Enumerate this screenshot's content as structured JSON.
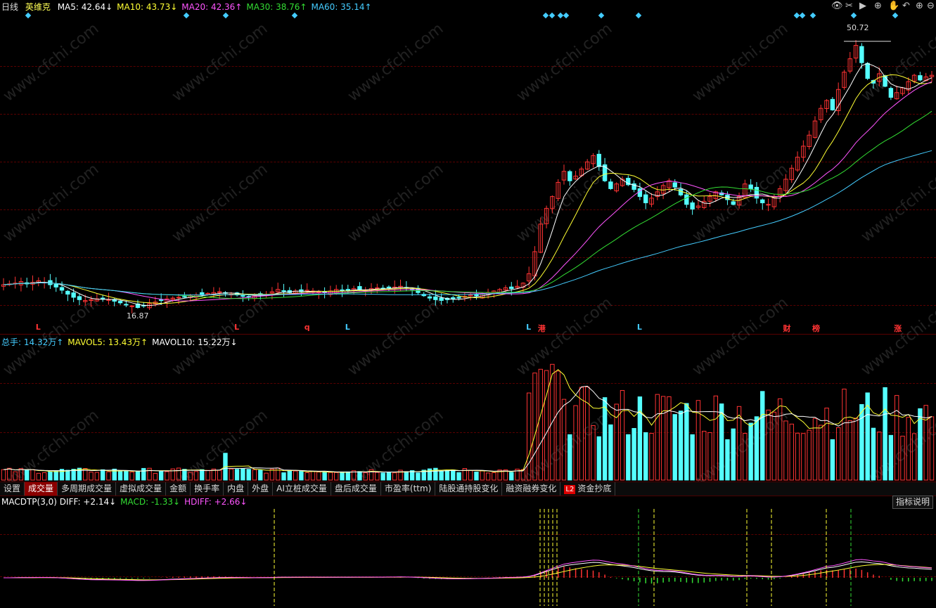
{
  "header": {
    "period": "日线",
    "stock_name": "英维克",
    "ma": [
      {
        "label": "MA5: 42.64",
        "arrow": "↓",
        "color": "#ffffff"
      },
      {
        "label": "MA10: 43.73",
        "arrow": "↓",
        "color": "#ffff33"
      },
      {
        "label": "MA20: 42.36",
        "arrow": "↑",
        "color": "#ff55ff"
      },
      {
        "label": "MA30: 38.76",
        "arrow": "↑",
        "color": "#33dd33"
      },
      {
        "label": "MA60: 35.14",
        "arrow": "↑",
        "color": "#44ccff"
      }
    ]
  },
  "toolbar_icons": [
    "eye-icon",
    "scissors-icon",
    "play-icon",
    "crosshair-icon",
    "hand-icon",
    "undo-icon",
    "zoom-in-icon",
    "zoom-out-icon"
  ],
  "annotations": {
    "high": "50.72",
    "low": "16.87"
  },
  "signals": [
    {
      "text": "L",
      "color": "#ff3333",
      "idx": 6
    },
    {
      "text": "L",
      "color": "#ff3333",
      "idx": 40
    },
    {
      "text": "q",
      "color": "#ff3333",
      "idx": 52
    },
    {
      "text": "L",
      "color": "#44ccff",
      "idx": 59
    },
    {
      "text": "L",
      "color": "#44ccff",
      "idx": 90
    },
    {
      "text": "港",
      "color": "#ff3333",
      "idx": 92
    },
    {
      "text": "L",
      "color": "#44ccff",
      "idx": 109
    },
    {
      "text": "财",
      "color": "#ff3333",
      "idx": 134
    },
    {
      "text": "榜",
      "color": "#ff3333",
      "idx": 139
    },
    {
      "text": "涨",
      "color": "#ff3333",
      "idx": 153
    }
  ],
  "volume_legend": [
    {
      "label": "总手: 14.32万",
      "arrow": "↑",
      "color": "#44ccff"
    },
    {
      "label": "MAVOL5: 13.43万",
      "arrow": "↑",
      "color": "#ffff33"
    },
    {
      "label": "MAVOL10: 15.22万",
      "arrow": "↓",
      "color": "#ffffff"
    }
  ],
  "tabs": [
    {
      "label": "设置",
      "active": false
    },
    {
      "label": "成交量",
      "active": true
    },
    {
      "label": "多周期成交量",
      "active": false
    },
    {
      "label": "虚拟成交量",
      "active": false
    },
    {
      "label": "金额",
      "active": false
    },
    {
      "label": "换手率",
      "active": false
    },
    {
      "label": "内盘",
      "active": false
    },
    {
      "label": "外盘",
      "active": false
    },
    {
      "label": "AI立桩成交量",
      "active": false
    },
    {
      "label": "盘后成交量",
      "active": false
    },
    {
      "label": "市盈率(ttm)",
      "active": false
    },
    {
      "label": "陆股通持股变化",
      "active": false
    },
    {
      "label": "融资融券变化",
      "active": false
    },
    {
      "label": "资金抄底",
      "active": false,
      "badge": "L2"
    }
  ],
  "macd_legend": [
    {
      "label": "MACDTP(3,0) DIFF: +2.14",
      "arrow": "↓",
      "color": "#ffffff"
    },
    {
      "label": "MACD: -1.33",
      "arrow": "↓",
      "color": "#33dd33"
    },
    {
      "label": "HDIFF: +2.66",
      "arrow": "↓",
      "color": "#ff55ff"
    }
  ],
  "explain_button": "指标说明",
  "watermark": "www.cfchi.com",
  "colors": {
    "up": "#ff3333",
    "down": "#55ffff",
    "grid": "#5a0000"
  },
  "chart_data": {
    "type": "candlestick",
    "y_range": [
      14,
      54
    ],
    "closes": [
      19.8,
      19.9,
      20.0,
      20.2,
      19.9,
      20.1,
      20.3,
      20.1,
      19.8,
      19.5,
      19.1,
      18.6,
      18.2,
      17.9,
      17.8,
      17.9,
      18.0,
      18.1,
      17.9,
      17.7,
      17.5,
      17.3,
      17.1,
      16.9,
      17.1,
      17.4,
      17.6,
      17.8,
      18.0,
      18.1,
      18.2,
      18.3,
      18.4,
      18.5,
      18.6,
      18.7,
      18.8,
      18.9,
      18.7,
      18.6,
      18.5,
      18.4,
      18.3,
      18.4,
      18.6,
      18.5,
      18.9,
      19.2,
      19.0,
      18.8,
      19.0,
      18.9,
      19.1,
      19.0,
      18.9,
      18.8,
      19.0,
      19.2,
      19.1,
      19.0,
      19.3,
      19.2,
      19.1,
      19.3,
      19.4,
      19.3,
      19.4,
      19.5,
      19.6,
      19.4,
      19.2,
      18.8,
      18.4,
      18.1,
      17.9,
      17.8,
      17.9,
      18.0,
      18.1,
      18.3,
      18.5,
      18.4,
      18.6,
      18.8,
      19.0,
      19.2,
      19.4,
      19.3,
      19.6,
      20.0,
      21.2,
      24.0,
      27.5,
      29.5,
      31.0,
      32.8,
      34.2,
      33.0,
      33.6,
      34.5,
      35.4,
      36.2,
      34.8,
      33.0,
      32.0,
      32.6,
      33.2,
      32.5,
      31.9,
      31.0,
      30.2,
      30.8,
      31.6,
      32.4,
      33.0,
      32.2,
      31.2,
      30.0,
      29.4,
      29.8,
      30.4,
      31.0,
      31.6,
      31.2,
      30.6,
      30.0,
      31.0,
      32.6,
      32.0,
      30.8,
      30.2,
      30.0,
      31.0,
      32.0,
      33.2,
      34.6,
      36.0,
      37.4,
      38.8,
      40.6,
      42.2,
      43.2,
      42.0,
      44.6,
      46.8,
      48.5,
      50.2,
      48.0,
      46.0,
      45.4,
      46.6,
      45.0,
      43.6,
      44.2,
      44.8,
      45.6,
      46.4,
      45.8,
      46.2,
      46.4
    ],
    "volume_range": [
      0,
      50
    ],
    "ma_series_names": [
      "MA5",
      "MA10",
      "MA20",
      "MA30",
      "MA60"
    ],
    "macd_series_names": [
      "DIFF",
      "MACD",
      "HDIFF"
    ]
  }
}
